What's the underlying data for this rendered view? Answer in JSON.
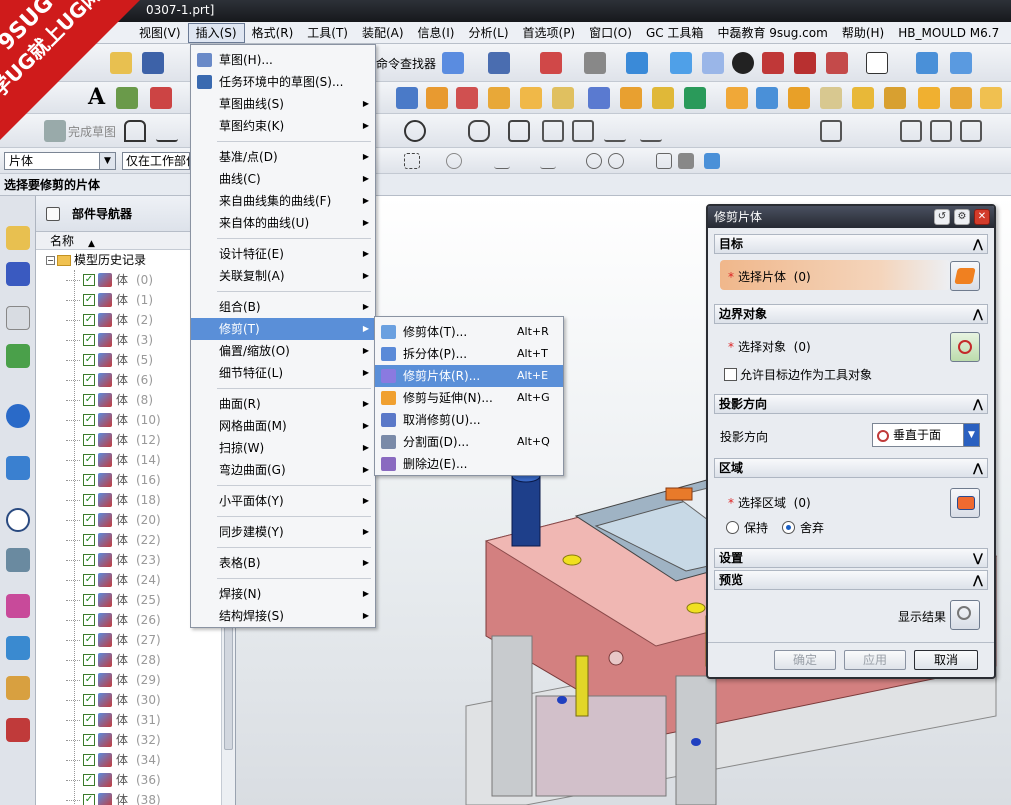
{
  "window": {
    "title_fragment": "0307-1.prt]"
  },
  "watermark": {
    "line1": "9SUG",
    "line2": "学UG就上UG网"
  },
  "menubar": [
    {
      "label": "视图(V)"
    },
    {
      "label": "插入(S)"
    },
    {
      "label": "格式(R)"
    },
    {
      "label": "工具(T)"
    },
    {
      "label": "装配(A)"
    },
    {
      "label": "信息(I)"
    },
    {
      "label": "分析(L)"
    },
    {
      "label": "首选项(P)"
    },
    {
      "label": "窗口(O)"
    },
    {
      "label": "GC 工具箱"
    },
    {
      "label": "中磊教育 9sug.com"
    },
    {
      "label": "帮助(H)"
    },
    {
      "label": "HB_MOULD M6.7"
    }
  ],
  "toolbar": {
    "command_finder": "命令查找器",
    "finish_sketch": "完成草图",
    "filter_value": "片体",
    "scope_value": "仅在工作部件"
  },
  "prompt": "选择要修剪的片体",
  "navigator": {
    "title": "部件导航器",
    "column_name": "名称",
    "root": "模型历史记录",
    "feature_label": "体",
    "features": [
      "(0)",
      "(1)",
      "(2)",
      "(3)",
      "(5)",
      "(6)",
      "(8)",
      "(10)",
      "(12)",
      "(14)",
      "(16)",
      "(18)",
      "(20)",
      "(22)",
      "(23)",
      "(24)",
      "(25)",
      "(26)",
      "(27)",
      "(28)",
      "(29)",
      "(30)",
      "(31)",
      "(32)",
      "(34)",
      "(36)",
      "(38)"
    ]
  },
  "insert_menu": [
    {
      "label": "草图(H)...",
      "type": "item",
      "icon": "sketch-icon"
    },
    {
      "label": "任务环境中的草图(S)...",
      "type": "item",
      "icon": "sketch-task-icon"
    },
    {
      "label": "草图曲线(S)",
      "type": "submenu"
    },
    {
      "label": "草图约束(K)",
      "type": "submenu"
    },
    {
      "type": "sep"
    },
    {
      "label": "基准/点(D)",
      "type": "submenu"
    },
    {
      "label": "曲线(C)",
      "type": "submenu"
    },
    {
      "label": "来自曲线集的曲线(F)",
      "type": "submenu"
    },
    {
      "label": "来自体的曲线(U)",
      "type": "submenu"
    },
    {
      "type": "sep"
    },
    {
      "label": "设计特征(E)",
      "type": "submenu"
    },
    {
      "label": "关联复制(A)",
      "type": "submenu"
    },
    {
      "type": "sep"
    },
    {
      "label": "组合(B)",
      "type": "submenu"
    },
    {
      "label": "修剪(T)",
      "type": "submenu",
      "highlighted": true
    },
    {
      "label": "偏置/缩放(O)",
      "type": "submenu"
    },
    {
      "label": "细节特征(L)",
      "type": "submenu"
    },
    {
      "type": "sep"
    },
    {
      "label": "曲面(R)",
      "type": "submenu"
    },
    {
      "label": "网格曲面(M)",
      "type": "submenu"
    },
    {
      "label": "扫掠(W)",
      "type": "submenu"
    },
    {
      "label": "弯边曲面(G)",
      "type": "submenu"
    },
    {
      "type": "sep"
    },
    {
      "label": "小平面体(Y)",
      "type": "submenu"
    },
    {
      "type": "sep"
    },
    {
      "label": "同步建模(Y)",
      "type": "submenu"
    },
    {
      "type": "sep"
    },
    {
      "label": "表格(B)",
      "type": "submenu"
    },
    {
      "type": "sep"
    },
    {
      "label": "焊接(N)",
      "type": "submenu"
    },
    {
      "label": "结构焊接(S)",
      "type": "submenu"
    }
  ],
  "trim_submenu": [
    {
      "label": "修剪体(T)...",
      "shortcut": "Alt+R",
      "icon": "trim-body-icon"
    },
    {
      "label": "拆分体(P)...",
      "shortcut": "Alt+T",
      "icon": "split-body-icon"
    },
    {
      "label": "修剪片体(R)...",
      "shortcut": "Alt+E",
      "icon": "trim-sheet-icon",
      "highlighted": true
    },
    {
      "label": "修剪与延伸(N)...",
      "shortcut": "Alt+G",
      "icon": "trim-extend-icon"
    },
    {
      "label": "取消修剪(U)...",
      "shortcut": "",
      "icon": "untrim-icon"
    },
    {
      "label": "分割面(D)...",
      "shortcut": "Alt+Q",
      "icon": "divide-face-icon"
    },
    {
      "label": "删除边(E)...",
      "shortcut": "",
      "icon": "delete-edge-icon"
    }
  ],
  "dialog": {
    "title": "修剪片体",
    "target": {
      "header": "目标",
      "select_label": "选择片体",
      "count": "(0)"
    },
    "boundary": {
      "header": "边界对象",
      "select_label": "选择对象",
      "count": "(0)",
      "allow_label": "允许目标边作为工具对象"
    },
    "projection": {
      "header": "投影方向",
      "label": "投影方向",
      "value": "垂直于面"
    },
    "region": {
      "header": "区域",
      "select_label": "选择区域",
      "count": "(0)",
      "keep": "保持",
      "discard": "舍弃"
    },
    "settings": {
      "header": "设置"
    },
    "preview": {
      "header": "预览",
      "show_result": "显示结果"
    },
    "buttons": {
      "ok": "确定",
      "apply": "应用",
      "cancel": "取消"
    }
  }
}
